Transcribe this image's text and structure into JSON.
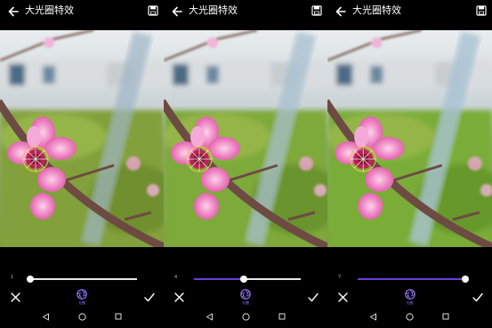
{
  "app": {
    "title": "大光圈特效"
  },
  "panels": [
    {
      "title": "大光圈特效",
      "slider": {
        "value": "1",
        "level": 0.0
      },
      "tool_label": "光圈"
    },
    {
      "title": "大光圈特效",
      "slider": {
        "value": "4",
        "level": 0.47
      },
      "tool_label": "光圈"
    },
    {
      "title": "大光圈特效",
      "slider": {
        "value": "7",
        "level": 1.0
      },
      "tool_label": "光圈"
    }
  ],
  "icons": {
    "back": "arrow-left-icon",
    "save": "save-icon",
    "cancel": "close-icon",
    "confirm": "check-icon",
    "aperture": "aperture-icon",
    "nav_back": "triangle-back-icon",
    "nav_home": "circle-home-icon",
    "nav_recent": "square-recent-icon"
  },
  "colors": {
    "accent": "#6b3ee0",
    "tool_label": "#8f72f5",
    "track": "#e8e8e8",
    "background": "#000000"
  }
}
